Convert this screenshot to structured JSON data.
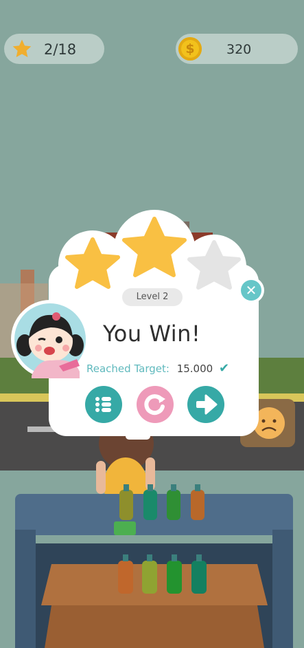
{
  "hud": {
    "stars_text": "2/18",
    "coins_text": "320",
    "star_icon": "star-icon",
    "coin_icon": "dollar-coin-icon",
    "coin_symbol": "$"
  },
  "popup": {
    "level_label": "Level 2",
    "title": "You Win!",
    "target_label": "Reached Target:",
    "target_value": "15.000",
    "stars_earned": 2,
    "stars_total": 3,
    "buttons": [
      {
        "name": "level-list-button",
        "icon": "list-icon"
      },
      {
        "name": "replay-button",
        "icon": "replay-icon"
      },
      {
        "name": "next-button",
        "icon": "arrow-right-icon"
      }
    ]
  },
  "colors": {
    "star_gold": "#f9c043",
    "star_grey": "#e4e4e4",
    "teal": "#36a9a6",
    "pink": "#ee9ab9",
    "target_text": "#5fb9bd"
  }
}
